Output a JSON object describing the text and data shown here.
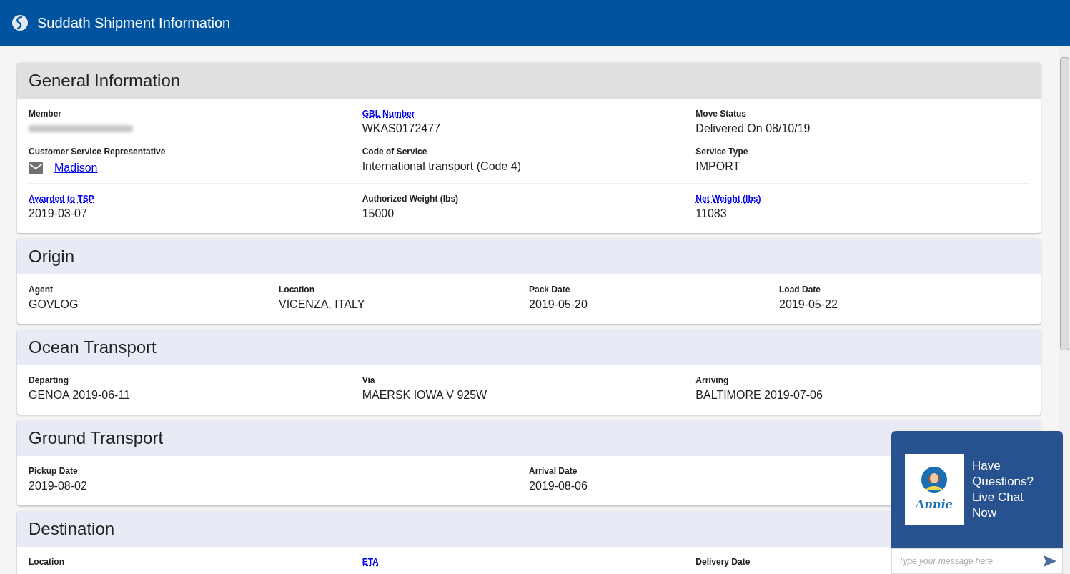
{
  "app_bar": {
    "title": "Suddath Shipment Information"
  },
  "sections": [
    {
      "title": "General Information",
      "highlighted": true,
      "rows": [
        {
          "fields": [
            {
              "label": "Member",
              "label_link": false,
              "kind": "redacted"
            },
            {
              "label": "GBL Number",
              "label_link": true,
              "kind": "text",
              "value": "WKAS0172477"
            },
            {
              "label": "Move Status",
              "label_link": false,
              "kind": "text",
              "value": "Delivered On 08/10/19"
            }
          ]
        },
        {
          "fields": [
            {
              "label": "Customer Service Representative",
              "label_link": false,
              "kind": "email_link",
              "value": "Madison"
            },
            {
              "label": "Code of Service",
              "label_link": false,
              "kind": "text",
              "value": "International transport (Code 4)"
            },
            {
              "label": "Service Type",
              "label_link": false,
              "kind": "text",
              "value": "IMPORT"
            }
          ]
        },
        {
          "ruled": true,
          "fields": [
            {
              "label": "Awarded to TSP",
              "label_link": true,
              "kind": "text",
              "value": "2019-03-07"
            },
            {
              "label": "Authorized Weight (lbs)",
              "label_link": false,
              "kind": "text",
              "value": "15000"
            },
            {
              "label": "Net Weight (lbs)",
              "label_link": true,
              "kind": "text",
              "value": "11083"
            }
          ]
        }
      ]
    },
    {
      "title": "Origin",
      "highlighted": false,
      "rows": [
        {
          "fields": [
            {
              "label": "Agent",
              "label_link": false,
              "kind": "text",
              "value": "GOVLOG"
            },
            {
              "label": "Location",
              "label_link": false,
              "kind": "text",
              "value": "VICENZA, ITALY"
            },
            {
              "label": "Pack Date",
              "label_link": false,
              "kind": "text",
              "value": "2019-05-20"
            },
            {
              "label": "Load Date",
              "label_link": false,
              "kind": "text",
              "value": "2019-05-22"
            }
          ]
        }
      ]
    },
    {
      "title": "Ocean Transport",
      "highlighted": false,
      "rows": [
        {
          "fields": [
            {
              "label": "Departing",
              "label_link": false,
              "kind": "text",
              "value": "GENOA 2019-06-11"
            },
            {
              "label": "Via",
              "label_link": false,
              "kind": "text",
              "value": "MAERSK IOWA V 925W"
            },
            {
              "label": "Arriving",
              "label_link": false,
              "kind": "text",
              "value": "BALTIMORE 2019-07-06"
            }
          ]
        }
      ]
    },
    {
      "title": "Ground Transport",
      "highlighted": false,
      "rows": [
        {
          "fields": [
            {
              "label": "Pickup Date",
              "label_link": false,
              "kind": "text",
              "value": "2019-08-02"
            },
            {
              "label": "Arrival Date",
              "label_link": false,
              "kind": "text",
              "value": "2019-08-06"
            }
          ]
        }
      ]
    },
    {
      "title": "Destination",
      "highlighted": false,
      "rows": [
        {
          "fields": [
            {
              "label": "Location",
              "label_link": false,
              "kind": "none"
            },
            {
              "label": "ETA",
              "label_link": true,
              "kind": "none"
            },
            {
              "label": "Delivery Date",
              "label_link": false,
              "kind": "none"
            }
          ]
        }
      ]
    }
  ],
  "chat": {
    "headline": "Have Questions? Live Chat Now",
    "brand": "Annie",
    "placeholder": "Type your message here"
  }
}
